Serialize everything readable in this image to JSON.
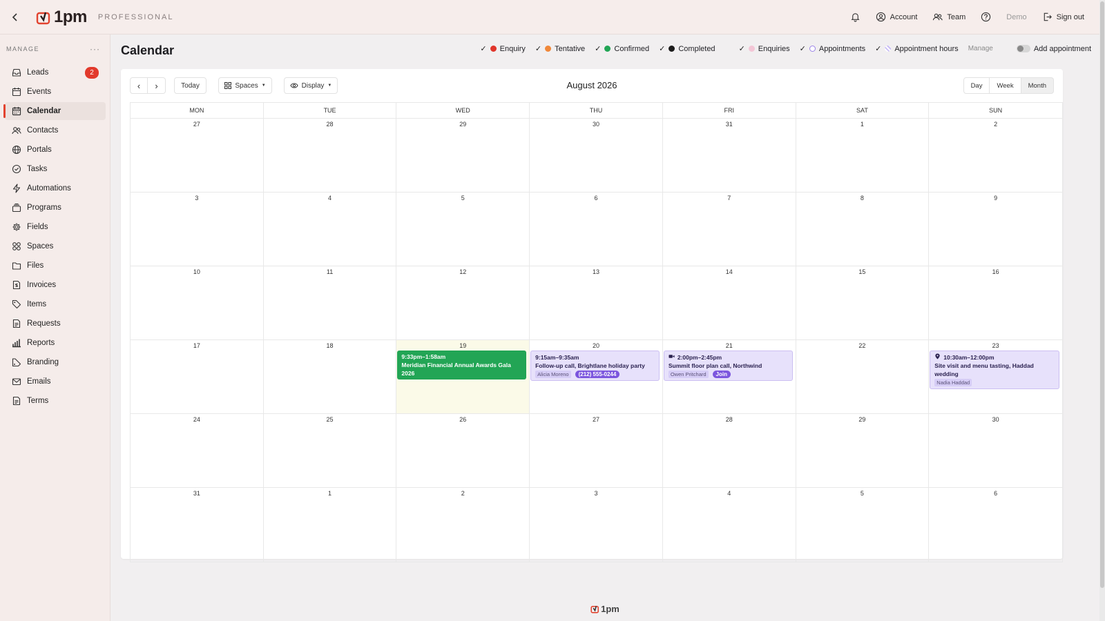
{
  "header": {
    "brand": "1pm",
    "plan": "PROFESSIONAL",
    "account_label": "Account",
    "team_label": "Team",
    "demo_label": "Demo",
    "signout_label": "Sign out"
  },
  "sidebar": {
    "section_title": "MANAGE",
    "more_label": "···",
    "items": [
      {
        "label": "Leads",
        "badge": "2"
      },
      {
        "label": "Events"
      },
      {
        "label": "Calendar"
      },
      {
        "label": "Contacts"
      },
      {
        "label": "Portals"
      },
      {
        "label": "Tasks"
      },
      {
        "label": "Automations"
      },
      {
        "label": "Programs"
      },
      {
        "label": "Fields"
      },
      {
        "label": "Spaces"
      },
      {
        "label": "Files"
      },
      {
        "label": "Invoices"
      },
      {
        "label": "Items"
      },
      {
        "label": "Requests"
      },
      {
        "label": "Reports"
      },
      {
        "label": "Branding"
      },
      {
        "label": "Emails"
      },
      {
        "label": "Terms"
      }
    ]
  },
  "page": {
    "title": "Calendar",
    "filters": [
      {
        "label": "Enquiry",
        "color": "#e0352b"
      },
      {
        "label": "Tentative",
        "color": "#f0883a"
      },
      {
        "label": "Confirmed",
        "color": "#22a555"
      },
      {
        "label": "Completed",
        "color": "#1c1c1c"
      },
      {
        "label": "Enquiries",
        "color": "#f3c6d6"
      },
      {
        "label": "Appointments",
        "color": "#9b83e8"
      },
      {
        "label": "Appointment hours",
        "color": "#c9bdf5"
      }
    ],
    "manage_label": "Manage",
    "add_appointment_label": "Add appointment"
  },
  "calendar": {
    "today_label": "Today",
    "spaces_label": "Spaces",
    "display_label": "Display",
    "month_label": "August 2026",
    "views": [
      "Day",
      "Week",
      "Month"
    ],
    "active_view": "Month",
    "weekdays": [
      "MON",
      "TUE",
      "WED",
      "THU",
      "FRI",
      "SAT",
      "SUN"
    ],
    "weeks": [
      [
        "27",
        "28",
        "29",
        "30",
        "31",
        "1",
        "2"
      ],
      [
        "3",
        "4",
        "5",
        "6",
        "7",
        "8",
        "9"
      ],
      [
        "10",
        "11",
        "12",
        "13",
        "14",
        "15",
        "16"
      ],
      [
        "17",
        "18",
        "19",
        "20",
        "21",
        "22",
        "23"
      ],
      [
        "24",
        "25",
        "26",
        "27",
        "28",
        "29",
        "30"
      ],
      [
        "31",
        "1",
        "2",
        "3",
        "4",
        "5",
        "6"
      ]
    ],
    "today": {
      "week": 3,
      "day": 2
    },
    "events": {
      "gala": {
        "time": "9:33pm–1:58am",
        "title": "Meridian Financial Annual Awards Gala 2026"
      },
      "followup": {
        "time": "9:15am–9:35am",
        "title": "Follow-up call, Brightlane holiday party",
        "person": "Alicia Moreno",
        "phone": "(212) 555-0244"
      },
      "summit": {
        "time": "2:00pm–2:45pm",
        "title": "Summit floor plan call, Northwind",
        "person": "Owen Pritchard",
        "action": "Join"
      },
      "tasting": {
        "time": "10:30am–12:00pm",
        "title": "Site visit and menu tasting, Haddad wedding",
        "person": "Nadia Haddad"
      }
    }
  },
  "footer": {
    "brand": "1pm"
  }
}
